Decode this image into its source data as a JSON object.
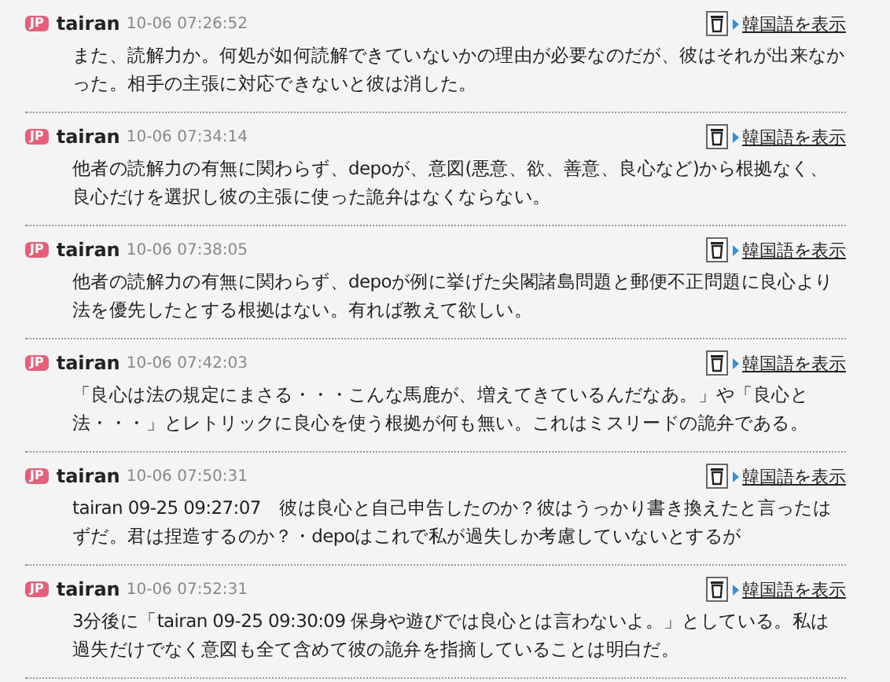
{
  "comments": [
    {
      "badge": "JP",
      "author": "tairan",
      "time": "10-06 07:26:52",
      "translate_link": "韓国語を表示",
      "body": "また、読解力か。何処が如何読解できていないかの理由が必要なのだが、彼はそれが出来なかった。相手の主張に対応できないと彼は消した。"
    },
    {
      "badge": "JP",
      "author": "tairan",
      "time": "10-06 07:34:14",
      "translate_link": "韓国語を表示",
      "body": "他者の読解力の有無に関わらず、depoが、意図(悪意、欲、善意、良心など)から根拠なく、良心だけを選択し彼の主張に使った詭弁はなくならない。"
    },
    {
      "badge": "JP",
      "author": "tairan",
      "time": "10-06 07:38:05",
      "translate_link": "韓国語を表示",
      "body": "他者の読解力の有無に関わらず、depoが例に挙げた尖閣諸島問題と郵便不正問題に良心より法を優先したとする根拠はない。有れば教えて欲しい。"
    },
    {
      "badge": "JP",
      "author": "tairan",
      "time": "10-06 07:42:03",
      "translate_link": "韓国語を表示",
      "body": "「良心は法の規定にまさる・・・こんな馬鹿が、増えてきているんだなあ。」や「良心と法・・・」とレトリックに良心を使う根拠が何も無い。これはミスリードの詭弁である。"
    },
    {
      "badge": "JP",
      "author": "tairan",
      "time": "10-06 07:50:31",
      "translate_link": "韓国語を表示",
      "body": "tairan 09-25 09:27:07　彼は良心と自己申告したのか？彼はうっかり書き換えたと言ったはずだ。君は捏造するのか？・depoはこれで私が過失しか考慮していないとするが"
    },
    {
      "badge": "JP",
      "author": "tairan",
      "time": "10-06 07:52:31",
      "translate_link": "韓国語を表示",
      "body": "3分後に「tairan 09-25 09:30:09 保身や遊びでは良心とは言わないよ。」としている。私は過失だけでなく意図も全て含めて彼の詭弁を指摘していることは明白だ。"
    }
  ]
}
